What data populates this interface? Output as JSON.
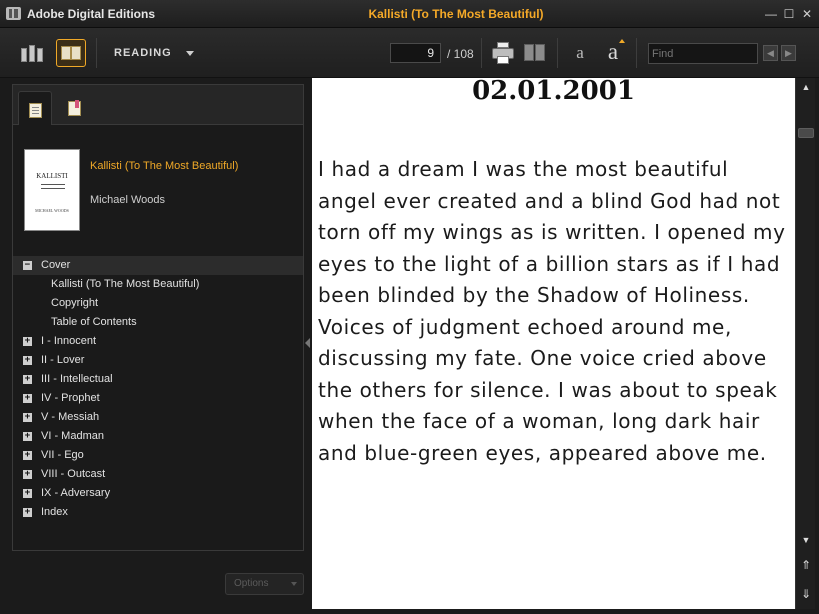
{
  "app": {
    "name": "Adobe Digital Editions",
    "window_title": "Kallisti (To The Most Beautiful)"
  },
  "window_controls": {
    "minimize": "—",
    "maximize": "☐",
    "close": "✕"
  },
  "toolbar": {
    "view_mode_label": "READING",
    "page_current": "9",
    "page_total": "/ 108",
    "font_small": "a",
    "font_large": "a",
    "find_placeholder": "Find",
    "find_prev": "◀",
    "find_next": "▶"
  },
  "book": {
    "title": "Kallisti (To The Most Beautiful)",
    "author": "Michael Woods",
    "cover": {
      "title": "KALLISTI",
      "author": "MICHAEL WOODS"
    }
  },
  "toc": [
    {
      "label": "Cover",
      "toggle": "−",
      "level": 0,
      "selected": true
    },
    {
      "label": "Kallisti (To The Most Beautiful)",
      "toggle": "",
      "level": 1
    },
    {
      "label": "Copyright",
      "toggle": "",
      "level": 1
    },
    {
      "label": "Table of Contents",
      "toggle": "",
      "level": 1
    },
    {
      "label": "I - Innocent",
      "toggle": "+",
      "level": 0
    },
    {
      "label": "II - Lover",
      "toggle": "+",
      "level": 0
    },
    {
      "label": "III - Intellectual",
      "toggle": "+",
      "level": 0
    },
    {
      "label": "IV - Prophet",
      "toggle": "+",
      "level": 0
    },
    {
      "label": "V - Messiah",
      "toggle": "+",
      "level": 0
    },
    {
      "label": "VI - Madman",
      "toggle": "+",
      "level": 0
    },
    {
      "label": "VII - Ego",
      "toggle": "+",
      "level": 0
    },
    {
      "label": "VIII - Outcast",
      "toggle": "+",
      "level": 0
    },
    {
      "label": "IX - Adversary",
      "toggle": "+",
      "level": 0
    },
    {
      "label": "Index",
      "toggle": "+",
      "level": 0
    }
  ],
  "options_label": "Options",
  "page": {
    "heading": "02.01.2001",
    "body": "I had a dream I was the most beautiful angel ever created and a blind God had not torn off my wings as is written. I opened my eyes to the light of a billion stars as if I had been blinded by the Shadow of Holiness. Voices of judgment echoed around me, discussing my fate. One voice cried above the others for silence. I was about to speak when the face of a woman, long dark hair and blue-green eyes, appeared above me."
  },
  "scrollbar": {
    "up": "▲",
    "down": "▼",
    "page_up": "⇑",
    "page_down": "⇓"
  }
}
